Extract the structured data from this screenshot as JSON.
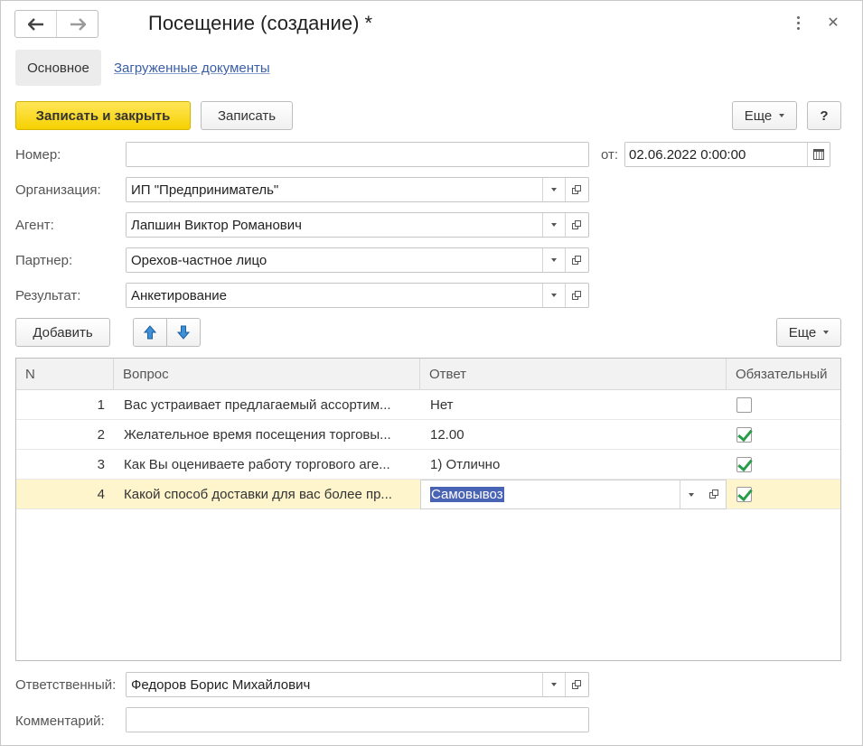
{
  "window": {
    "title": "Посещение (создание) *",
    "tabs": [
      {
        "label": "Основное",
        "active": true
      },
      {
        "label": "Загруженные документы",
        "active": false
      }
    ]
  },
  "toolbar": {
    "save_close_label": "Записать и закрыть",
    "save_label": "Записать",
    "more_label": "Еще",
    "help_label": "?"
  },
  "form": {
    "number": {
      "label": "Номер:",
      "value": ""
    },
    "date": {
      "label": "от:",
      "value": "02.06.2022  0:00:00"
    },
    "organization": {
      "label": "Организация:",
      "value": "ИП \"Предприниматель\""
    },
    "agent": {
      "label": "Агент:",
      "value": "Лапшин Виктор Романович"
    },
    "partner": {
      "label": "Партнер:",
      "value": "Орехов-частное лицо"
    },
    "result": {
      "label": "Результат:",
      "value": "Анкетирование"
    },
    "responsible": {
      "label": "Ответственный:",
      "value": "Федоров Борис Михайлович"
    },
    "comment": {
      "label": "Комментарий:",
      "value": ""
    }
  },
  "table_toolbar": {
    "add_label": "Добавить",
    "more_label": "Еще"
  },
  "table": {
    "columns": [
      "N",
      "Вопрос",
      "Ответ",
      "Обязательный"
    ],
    "rows": [
      {
        "n": "1",
        "question": "Вас устраивает предлагаемый ассортим...",
        "answer": "Нет",
        "required": false
      },
      {
        "n": "2",
        "question": "Желательное время посещения торговы...",
        "answer": "12.00",
        "required": true
      },
      {
        "n": "3",
        "question": "Как Вы оцениваете работу торгового аге...",
        "answer": "1) Отлично",
        "required": true
      },
      {
        "n": "4",
        "question": "Какой способ доставки для вас более пр...",
        "answer": "Самовывоз",
        "required": true
      }
    ]
  },
  "colors": {
    "primary_button": "#f6d100",
    "selected_row": "#fff5cc",
    "selection": "#4a64b5",
    "link": "#3a5fa6",
    "check": "#2a9d4a"
  }
}
